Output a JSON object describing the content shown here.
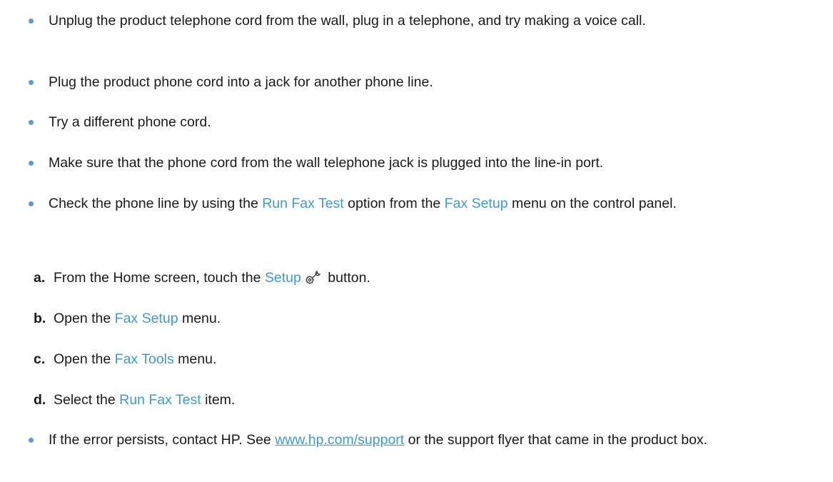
{
  "bullets": [
    {
      "text": "Unplug the product telephone cord from the wall, plug in a telephone, and try making a voice call."
    },
    {
      "text": "Plug the product phone cord into a jack for another phone line."
    },
    {
      "text": "Try a different phone cord."
    },
    {
      "text": "Make sure that the phone cord from the wall telephone jack is plugged into the line-in port."
    },
    {
      "pre": "Check the phone line by using the ",
      "ui1": "Run Fax Test",
      "mid": " option from the ",
      "ui2": "Fax Setup",
      "post": " menu on the control panel."
    },
    {
      "pre": "If the error persists, contact HP. See ",
      "link": "www.hp.com/support",
      "post": " or the support flyer that came in the product box."
    }
  ],
  "steps": [
    {
      "letter": "a.",
      "pre": "From the Home screen, touch the ",
      "ui": "Setup",
      "post": " button.",
      "icon": "setup-wrench-gear-icon"
    },
    {
      "letter": "b.",
      "pre": "Open the ",
      "ui": "Fax Setup",
      "post": " menu."
    },
    {
      "letter": "c.",
      "pre": "Open the ",
      "ui": "Fax Tools",
      "post": " menu."
    },
    {
      "letter": "d.",
      "pre": "Select the ",
      "ui": "Run Fax Test",
      "post": " item."
    }
  ],
  "colors": {
    "bullet": "#5b9bd5",
    "ui_term": "#3d9ad9",
    "text": "#1a1a1a"
  }
}
